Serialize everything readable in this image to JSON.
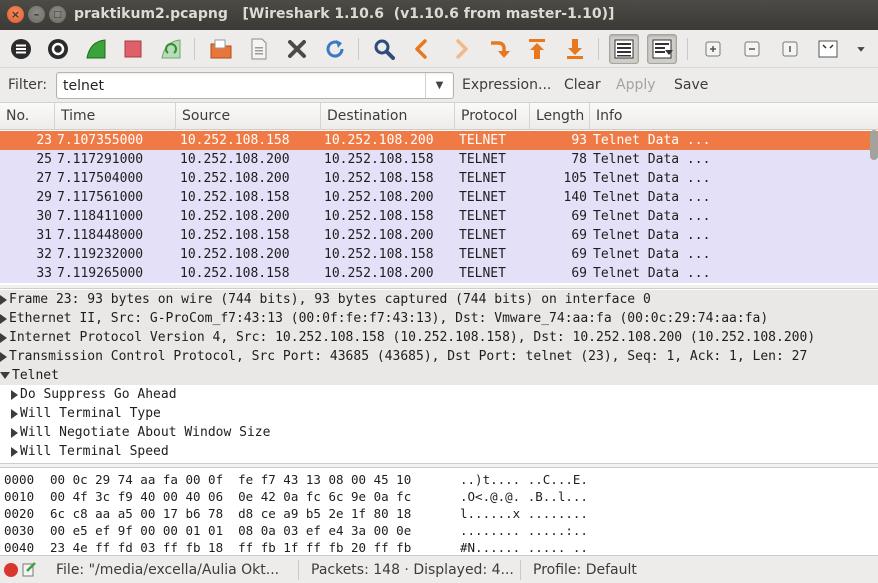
{
  "window": {
    "title": "praktikum2.pcapng   [Wireshark 1.10.6  (v1.10.6 from master-1.10)]",
    "close_glyph": "×",
    "min_glyph": "–",
    "max_glyph": "□"
  },
  "toolbar": {
    "icons": [
      "interface-list-icon",
      "capture-options-icon",
      "start-capture-icon",
      "stop-capture-icon",
      "restart-capture-icon",
      "open-file-icon",
      "save-file-icon",
      "close-file-icon",
      "reload-icon",
      "find-packet-icon",
      "go-back-icon",
      "go-forward-icon",
      "go-to-packet-icon",
      "go-first-icon",
      "go-last-icon",
      "colorize-icon",
      "autoscroll-icon",
      "zoom-in-icon",
      "zoom-out-icon",
      "normal-size-icon",
      "resize-columns-icon",
      "more-icon"
    ]
  },
  "filter": {
    "label": "Filter:",
    "value": "telnet",
    "expression": "Expression...",
    "clear": "Clear",
    "apply": "Apply",
    "save": "Save"
  },
  "packet_list": {
    "columns": [
      "No.",
      "Time",
      "Source",
      "Destination",
      "Protocol",
      "Length",
      "Info"
    ],
    "rows": [
      {
        "no": "23",
        "time": "7.107355000",
        "src": "10.252.108.158",
        "dst": "10.252.108.200",
        "proto": "TELNET",
        "len": "93",
        "info": "Telnet Data ..."
      },
      {
        "no": "25",
        "time": "7.117291000",
        "src": "10.252.108.200",
        "dst": "10.252.108.158",
        "proto": "TELNET",
        "len": "78",
        "info": "Telnet Data ..."
      },
      {
        "no": "27",
        "time": "7.117504000",
        "src": "10.252.108.200",
        "dst": "10.252.108.158",
        "proto": "TELNET",
        "len": "105",
        "info": "Telnet Data ..."
      },
      {
        "no": "29",
        "time": "7.117561000",
        "src": "10.252.108.158",
        "dst": "10.252.108.200",
        "proto": "TELNET",
        "len": "140",
        "info": "Telnet Data ..."
      },
      {
        "no": "30",
        "time": "7.118411000",
        "src": "10.252.108.200",
        "dst": "10.252.108.158",
        "proto": "TELNET",
        "len": "69",
        "info": "Telnet Data ..."
      },
      {
        "no": "31",
        "time": "7.118448000",
        "src": "10.252.108.158",
        "dst": "10.252.108.200",
        "proto": "TELNET",
        "len": "69",
        "info": "Telnet Data ..."
      },
      {
        "no": "32",
        "time": "7.119232000",
        "src": "10.252.108.200",
        "dst": "10.252.108.158",
        "proto": "TELNET",
        "len": "69",
        "info": "Telnet Data ..."
      },
      {
        "no": "33",
        "time": "7.119265000",
        "src": "10.252.108.158",
        "dst": "10.252.108.200",
        "proto": "TELNET",
        "len": "69",
        "info": "Telnet Data ..."
      }
    ]
  },
  "details": {
    "rows": [
      "Frame 23: 93 bytes on wire (744 bits), 93 bytes captured (744 bits) on interface 0",
      "Ethernet II, Src: G-ProCom_f7:43:13 (00:0f:fe:f7:43:13), Dst: Vmware_74:aa:fa (00:0c:29:74:aa:fa)",
      "Internet Protocol Version 4, Src: 10.252.108.158 (10.252.108.158), Dst: 10.252.108.200 (10.252.108.200)",
      "Transmission Control Protocol, Src Port: 43685 (43685), Dst Port: telnet (23), Seq: 1, Ack: 1, Len: 27",
      "Telnet",
      "Do Suppress Go Ahead",
      "Will Terminal Type",
      "Will Negotiate About Window Size",
      "Will Terminal Speed"
    ]
  },
  "bytes": {
    "rows": [
      {
        "offset": "0000",
        "hex": "00 0c 29 74 aa fa 00 0f  fe f7 43 13 08 00 45 10",
        "ascii": "..)t.... ..C...E."
      },
      {
        "offset": "0010",
        "hex": "00 4f 3c f9 40 00 40 06  0e 42 0a fc 6c 9e 0a fc",
        "ascii": ".O<.@.@. .B..l..."
      },
      {
        "offset": "0020",
        "hex": "6c c8 aa a5 00 17 b6 78  d8 ce a9 b5 2e 1f 80 18",
        "ascii": "l......x ........"
      },
      {
        "offset": "0030",
        "hex": "00 e5 ef 9f 00 00 01 01  08 0a 03 ef e4 3a 00 0e",
        "ascii": "........ .....:.."
      },
      {
        "offset": "0040",
        "hex": "23 4e ff fd 03 ff fb 18  ff fb 1f ff fb 20 ff fb",
        "ascii": "#N...... ..... .."
      }
    ]
  },
  "status": {
    "file": "File: \"/media/excella/Aulia Okt...",
    "packets": "Packets: 148 · Displayed: 4...",
    "profile": "Profile: Default"
  },
  "colors": {
    "selected_row": "#f07a45",
    "telnet_row": "#e4e0f8",
    "titlebar": "#3c3b37"
  }
}
